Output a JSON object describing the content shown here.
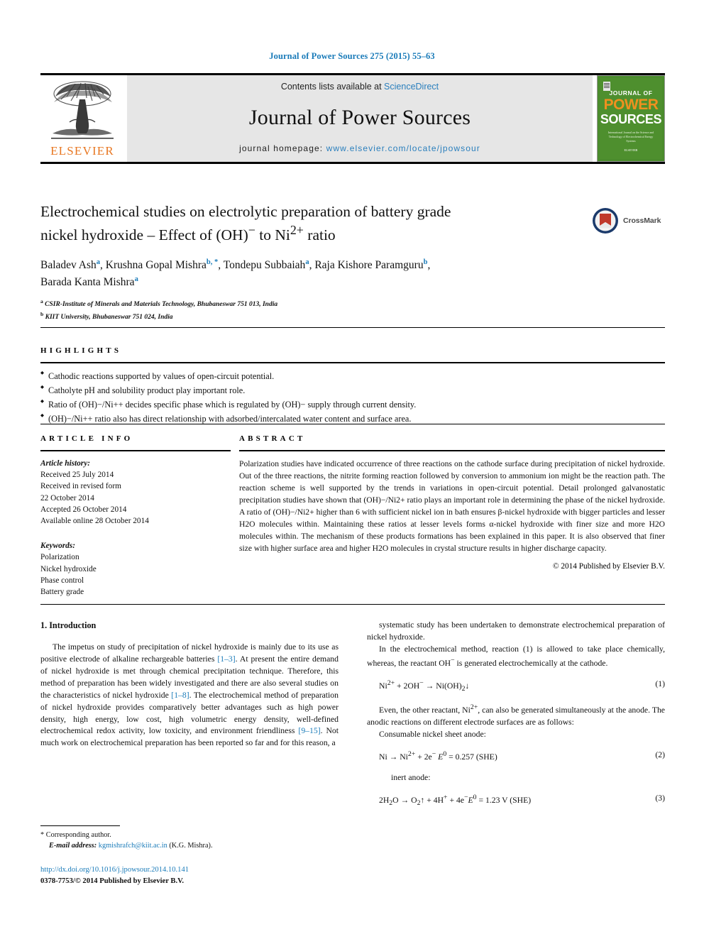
{
  "running_head": "Journal of Power Sources 275 (2015) 55–63",
  "masthead": {
    "publisher": "ELSEVIER",
    "contents_prefix": "Contents lists available at ",
    "contents_link": "ScienceDirect",
    "journal_name": "Journal of Power Sources",
    "homepage_prefix": "journal homepage: ",
    "homepage_url": "www.elsevier.com/locate/jpowsour",
    "cover": {
      "line1": "JOURNAL OF",
      "line2": "POWER",
      "line3": "SOURCES",
      "subtitle": "International Journal on the Science and Technology of Electrochemical Energy Systems",
      "footer": "ELSEVIER"
    }
  },
  "article": {
    "title_line1": "Electrochemical studies on electrolytic preparation of battery grade",
    "title_line2_a": "nickel hydroxide – Effect of (OH)",
    "title_line2_sup1": "−",
    "title_line2_b": " to Ni",
    "title_line2_sup2": "2+",
    "title_line2_c": " ratio",
    "crossmark_label": "CrossMark",
    "authors": [
      {
        "name": "Baladev Ash",
        "sup": "a",
        "sep": ", "
      },
      {
        "name": "Krushna Gopal Mishra",
        "sup": "b, *",
        "sep": ", "
      },
      {
        "name": "Tondepu Subbaiah",
        "sup": "a",
        "sep": ", "
      },
      {
        "name": "Raja Kishore Paramguru",
        "sup": "b",
        "sep": ", "
      },
      {
        "name": "Barada Kanta Mishra",
        "sup": "a",
        "sep": ""
      }
    ],
    "affiliations": [
      {
        "marker": "a",
        "text": "CSIR-Institute of Minerals and Materials Technology, Bhubaneswar 751 013, India"
      },
      {
        "marker": "b",
        "text": "KIIT University, Bhubaneswar 751 024, India"
      }
    ]
  },
  "highlights": {
    "heading": "HIGHLIGHTS",
    "items": [
      "Cathodic reactions supported by values of open-circuit potential.",
      "Catholyte pH and solubility product play important role.",
      "Ratio of (OH)−/Ni++ decides specific phase which is regulated by (OH)− supply through current density.",
      "(OH)−/Ni++ ratio also has direct relationship with adsorbed/intercalated water content and surface area."
    ]
  },
  "article_info": {
    "heading": "ARTICLE INFO",
    "history_label": "Article history:",
    "history": [
      "Received 25 July 2014",
      "Received in revised form",
      "22 October 2014",
      "Accepted 26 October 2014",
      "Available online 28 October 2014"
    ],
    "keywords_label": "Keywords:",
    "keywords": [
      "Polarization",
      "Nickel hydroxide",
      "Phase control",
      "Battery grade"
    ]
  },
  "abstract": {
    "heading": "ABSTRACT",
    "text": "Polarization studies have indicated occurrence of three reactions on the cathode surface during precipitation of nickel hydroxide. Out of the three reactions, the nitrite forming reaction followed by conversion to ammonium ion might be the reaction path. The reaction scheme is well supported by the trends in variations in open-circuit potential. Detail prolonged galvanostatic precipitation studies have shown that (OH)−/Ni2+ ratio plays an important role in determining the phase of the nickel hydroxide. A ratio of (OH)−/Ni2+ higher than 6 with sufficient nickel ion in bath ensures β-nickel hydroxide with bigger particles and lesser H2O molecules within. Maintaining these ratios at lesser levels forms α-nickel hydroxide with finer size and more H2O molecules within. The mechanism of these products formations has been explained in this paper. It is also observed that finer size with higher surface area and higher H2O molecules in crystal structure results in higher discharge capacity.",
    "copyright": "© 2014 Published by Elsevier B.V."
  },
  "body": {
    "section_heading": "1.  Introduction",
    "left_p1_a": "The impetus on study of precipitation of nickel hydroxide is mainly due to its use as positive electrode of alkaline rechargeable batteries ",
    "left_p1_cite1": "[1–3]",
    "left_p1_b": ". At present the entire demand of nickel hydroxide is met through chemical precipitation technique. Therefore, this method of preparation has been widely investigated and there are also several studies on the characteristics of nickel hydroxide ",
    "left_p1_cite2": "[1–8]",
    "left_p1_c": ". The electrochemical method of preparation of nickel hydroxide provides comparatively better advantages such as high power density, high energy, low cost, high volumetric energy density, well-defined electrochemical redox activity, low toxicity, and environment friendliness ",
    "left_p1_cite3": "[9–15]",
    "left_p1_d": ". Not much work on electrochemical preparation has been reported so far and for this reason, a",
    "right_p1": "systematic study has been undertaken to demonstrate electrochemical preparation of nickel hydroxide.",
    "right_p2": "In the electrochemical method, reaction (1) is allowed to take place chemically, whereas, the reactant OH− is generated electrochemically at the cathode.",
    "eq1_body": "Ni2+ + 2OH− → Ni(OH)2↓",
    "eq1_num": "(1)",
    "right_p3": "Even, the other reactant, Ni2+, can also be generated simultaneously at the anode. The anodic reactions on different electrode surfaces are as follows:",
    "right_p4": "Consumable nickel sheet anode:",
    "eq2_body": "Ni → Ni2+ + 2e− E0 = 0.257 (SHE)",
    "eq2_num": "(2)",
    "right_p5": "inert anode:",
    "eq3_body": "2H2O → O2↑ + 4H+ + 4e−E0 = 1.23 V (SHE)",
    "eq3_num": "(3)"
  },
  "footer": {
    "corresponding_marker": "*",
    "corresponding_label": "Corresponding author.",
    "email_label": "E-mail address:",
    "email": "kgmishrafch@kiit.ac.in",
    "email_owner": "(K.G. Mishra).",
    "doi": "http://dx.doi.org/10.1016/j.jpowsour.2014.10.141",
    "issn": "0378-7753/© 2014 Published by Elsevier B.V."
  },
  "colors": {
    "link": "#1a7bb9",
    "elsevier_orange": "#E87722",
    "cover_green": "#4a8b2c"
  }
}
